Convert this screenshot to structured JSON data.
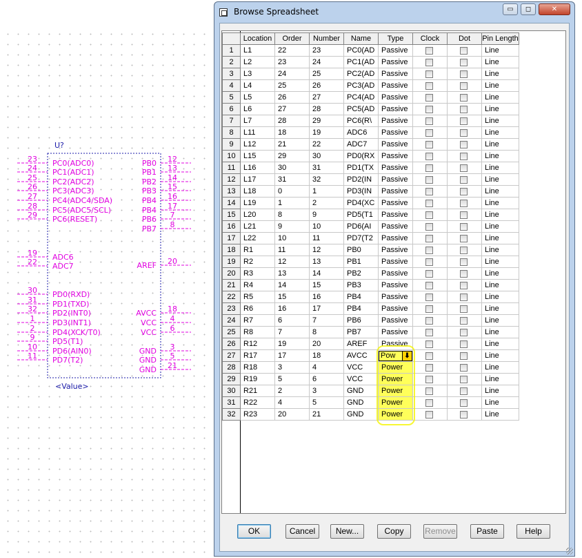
{
  "window": {
    "title": "Browse Spreadsheet",
    "minimize_glyph": "▭",
    "restore_glyph": "◻",
    "close_glyph": "✕"
  },
  "columns": [
    "Location",
    "Order",
    "Number",
    "Name",
    "Type",
    "Clock",
    "Dot",
    "Pin Length"
  ],
  "rows": [
    {
      "n": "1",
      "loc": "L1",
      "order": "22",
      "number": "23",
      "name": "PC0(AD",
      "type": "Passive",
      "len": "Line"
    },
    {
      "n": "2",
      "loc": "L2",
      "order": "23",
      "number": "24",
      "name": "PC1(AD",
      "type": "Passive",
      "len": "Line"
    },
    {
      "n": "3",
      "loc": "L3",
      "order": "24",
      "number": "25",
      "name": "PC2(AD",
      "type": "Passive",
      "len": "Line"
    },
    {
      "n": "4",
      "loc": "L4",
      "order": "25",
      "number": "26",
      "name": "PC3(AD",
      "type": "Passive",
      "len": "Line"
    },
    {
      "n": "5",
      "loc": "L5",
      "order": "26",
      "number": "27",
      "name": "PC4(AD",
      "type": "Passive",
      "len": "Line"
    },
    {
      "n": "6",
      "loc": "L6",
      "order": "27",
      "number": "28",
      "name": "PC5(AD",
      "type": "Passive",
      "len": "Line"
    },
    {
      "n": "7",
      "loc": "L7",
      "order": "28",
      "number": "29",
      "name": "PC6(R\\",
      "type": "Passive",
      "len": "Line"
    },
    {
      "n": "8",
      "loc": "L11",
      "order": "18",
      "number": "19",
      "name": "ADC6",
      "type": "Passive",
      "len": "Line"
    },
    {
      "n": "9",
      "loc": "L12",
      "order": "21",
      "number": "22",
      "name": "ADC7",
      "type": "Passive",
      "len": "Line"
    },
    {
      "n": "10",
      "loc": "L15",
      "order": "29",
      "number": "30",
      "name": "PD0(RX",
      "type": "Passive",
      "len": "Line"
    },
    {
      "n": "11",
      "loc": "L16",
      "order": "30",
      "number": "31",
      "name": "PD1(TX",
      "type": "Passive",
      "len": "Line"
    },
    {
      "n": "12",
      "loc": "L17",
      "order": "31",
      "number": "32",
      "name": "PD2(IN",
      "type": "Passive",
      "len": "Line"
    },
    {
      "n": "13",
      "loc": "L18",
      "order": "0",
      "number": "1",
      "name": "PD3(IN",
      "type": "Passive",
      "len": "Line"
    },
    {
      "n": "14",
      "loc": "L19",
      "order": "1",
      "number": "2",
      "name": "PD4(XC",
      "type": "Passive",
      "len": "Line"
    },
    {
      "n": "15",
      "loc": "L20",
      "order": "8",
      "number": "9",
      "name": "PD5(T1",
      "type": "Passive",
      "len": "Line"
    },
    {
      "n": "16",
      "loc": "L21",
      "order": "9",
      "number": "10",
      "name": "PD6(AI",
      "type": "Passive",
      "len": "Line"
    },
    {
      "n": "17",
      "loc": "L22",
      "order": "10",
      "number": "11",
      "name": "PD7(T2",
      "type": "Passive",
      "len": "Line"
    },
    {
      "n": "18",
      "loc": "R1",
      "order": "11",
      "number": "12",
      "name": "PB0",
      "type": "Passive",
      "len": "Line"
    },
    {
      "n": "19",
      "loc": "R2",
      "order": "12",
      "number": "13",
      "name": "PB1",
      "type": "Passive",
      "len": "Line"
    },
    {
      "n": "20",
      "loc": "R3",
      "order": "13",
      "number": "14",
      "name": "PB2",
      "type": "Passive",
      "len": "Line"
    },
    {
      "n": "21",
      "loc": "R4",
      "order": "14",
      "number": "15",
      "name": "PB3",
      "type": "Passive",
      "len": "Line"
    },
    {
      "n": "22",
      "loc": "R5",
      "order": "15",
      "number": "16",
      "name": "PB4",
      "type": "Passive",
      "len": "Line"
    },
    {
      "n": "23",
      "loc": "R6",
      "order": "16",
      "number": "17",
      "name": "PB4",
      "type": "Passive",
      "len": "Line"
    },
    {
      "n": "24",
      "loc": "R7",
      "order": "6",
      "number": "7",
      "name": "PB6",
      "type": "Passive",
      "len": "Line"
    },
    {
      "n": "25",
      "loc": "R8",
      "order": "7",
      "number": "8",
      "name": "PB7",
      "type": "Passive",
      "len": "Line"
    },
    {
      "n": "26",
      "loc": "R12",
      "order": "19",
      "number": "20",
      "name": "AREF",
      "type": "Passive",
      "len": "Line"
    },
    {
      "n": "27",
      "loc": "R17",
      "order": "17",
      "number": "18",
      "name": "AVCC",
      "type": "Pow",
      "len": "Line",
      "editing": true
    },
    {
      "n": "28",
      "loc": "R18",
      "order": "3",
      "number": "4",
      "name": "VCC",
      "type": "Power",
      "len": "Line"
    },
    {
      "n": "29",
      "loc": "R19",
      "order": "5",
      "number": "6",
      "name": "VCC",
      "type": "Power",
      "len": "Line"
    },
    {
      "n": "30",
      "loc": "R21",
      "order": "2",
      "number": "3",
      "name": "GND",
      "type": "Power",
      "len": "Line"
    },
    {
      "n": "31",
      "loc": "R22",
      "order": "4",
      "number": "5",
      "name": "GND",
      "type": "Power",
      "len": "Line"
    },
    {
      "n": "32",
      "loc": "R23",
      "order": "20",
      "number": "21",
      "name": "GND",
      "type": "Power",
      "len": "Line"
    }
  ],
  "buttons": {
    "ok": "OK",
    "cancel": "Cancel",
    "new": "New...",
    "copy": "Copy",
    "remove": "Remove",
    "paste": "Paste",
    "help": "Help"
  },
  "schematic": {
    "refdes": "U?",
    "value": "<Value>",
    "left_pins": [
      {
        "num": "23",
        "name": "PC0(ADC0)"
      },
      {
        "num": "24",
        "name": "PC1(ADC1)"
      },
      {
        "num": "25",
        "name": "PC2(ADC2)"
      },
      {
        "num": "26",
        "name": "PC3(ADC3)"
      },
      {
        "num": "27",
        "name": "PC4(ADC4/SDA)"
      },
      {
        "num": "28",
        "name": "PC5(ADC5/SCL)"
      },
      {
        "num": "29",
        "name": "PC6(RESET)"
      },
      {
        "num": "19",
        "name": "ADC6"
      },
      {
        "num": "22",
        "name": "ADC7"
      },
      {
        "num": "30",
        "name": "PD0(RXD)"
      },
      {
        "num": "31",
        "name": "PD1(TXD)"
      },
      {
        "num": "32",
        "name": "PD2(INT0)"
      },
      {
        "num": "1",
        "name": "PD3(INT1)"
      },
      {
        "num": "2",
        "name": "PD4(XCK/T0)"
      },
      {
        "num": "9",
        "name": "PD5(T1)"
      },
      {
        "num": "10",
        "name": "PD6(AIN0)"
      },
      {
        "num": "11",
        "name": "PD7(T2)"
      }
    ],
    "right_pins": [
      {
        "num": "12",
        "name": "PB0"
      },
      {
        "num": "13",
        "name": "PB1"
      },
      {
        "num": "14",
        "name": "PB2"
      },
      {
        "num": "15",
        "name": "PB3"
      },
      {
        "num": "16",
        "name": "PB4"
      },
      {
        "num": "17",
        "name": "PB4"
      },
      {
        "num": "7",
        "name": "PB6"
      },
      {
        "num": "8",
        "name": "PB7"
      },
      {
        "num": "20",
        "name": "AREF"
      },
      {
        "num": "18",
        "name": "AVCC"
      },
      {
        "num": "4",
        "name": "VCC"
      },
      {
        "num": "6",
        "name": "VCC"
      },
      {
        "num": "3",
        "name": "GND"
      },
      {
        "num": "5",
        "name": "GND"
      },
      {
        "num": "21",
        "name": "GND"
      }
    ]
  },
  "colors": {
    "pin": "#e000e0",
    "outline": "#1a1aa8",
    "highlight": "#ffff00"
  }
}
